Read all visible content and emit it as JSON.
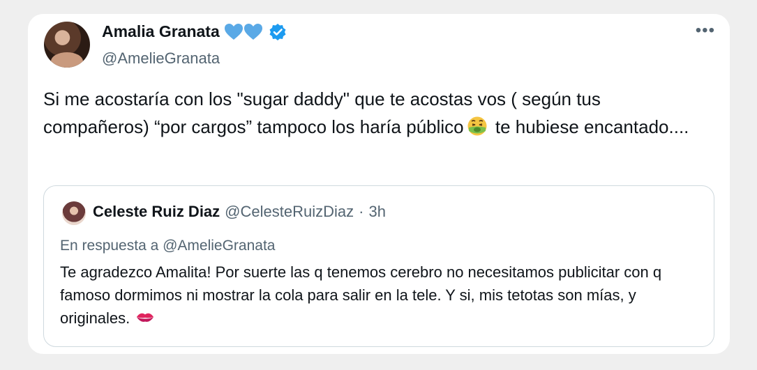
{
  "tweet": {
    "author_name": "Amalia Granata",
    "author_handle": "@AmelieGranata",
    "more_label": "•••",
    "body_part1": "Si me acostaría con los  \"sugar daddy\" que te acostas vos ( según tus compañeros) “por cargos” tampoco los haría público",
    "body_part2": " te hubiese encantado....",
    "colors": {
      "heart": "#5aa9e6",
      "verified": "#1d9bf0",
      "text": "#0f1419",
      "secondary": "#536471"
    }
  },
  "quoted": {
    "author_name": "Celeste Ruiz Diaz",
    "author_handle": "@CelesteRuizDiaz",
    "separator": "·",
    "time": "3h",
    "reply_to": "En respuesta a @AmelieGranata",
    "text": "Te agradezco Amalita! Por suerte las q tenemos cerebro no necesitamos publicitar con q famoso dormimos ni mostrar la cola para salir en la tele. Y si, mis tetotas son mías, y originales."
  },
  "icons": [
    "blue-heart-icon",
    "verified-badge-icon",
    "nauseated-face-emoji-icon",
    "kiss-mark-emoji-icon",
    "more-options-icon"
  ]
}
